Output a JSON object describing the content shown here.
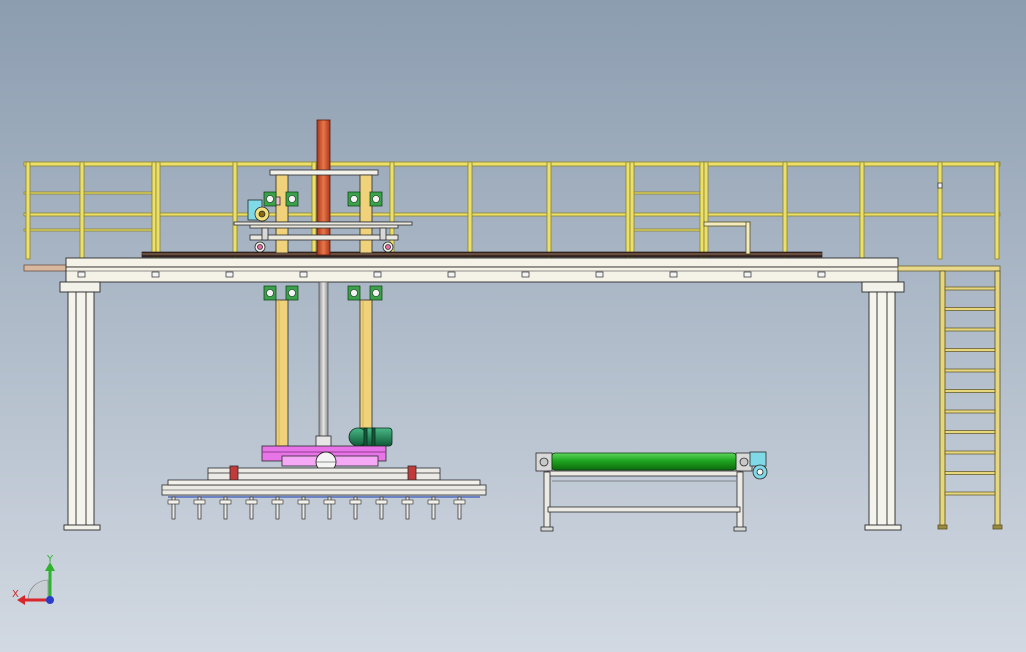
{
  "viewport": {
    "background_top": "#8c9db0",
    "background_bottom": "#d2d9e2"
  },
  "colors": {
    "railing": "#ece06a",
    "railing_edge": "#8a8230",
    "column_pale": "#f2f1ea",
    "column_yellow": "#f0d27a",
    "rod_red": "#d9592e",
    "rod_grey": "#c9c9c9",
    "motor_green": "#1f8a5a",
    "roller_green": "#1fa61f",
    "magenta_plate": "#e875e8",
    "cyan_motor": "#7fd9e6",
    "dark_line": "#2a2a2a",
    "ladder_yellow": "#e6d77e"
  },
  "triad": {
    "x_label": "X",
    "y_label": "Y",
    "x_color": "#d8262a",
    "y_color": "#2fb32f",
    "z_color": "#2a3cc8"
  }
}
